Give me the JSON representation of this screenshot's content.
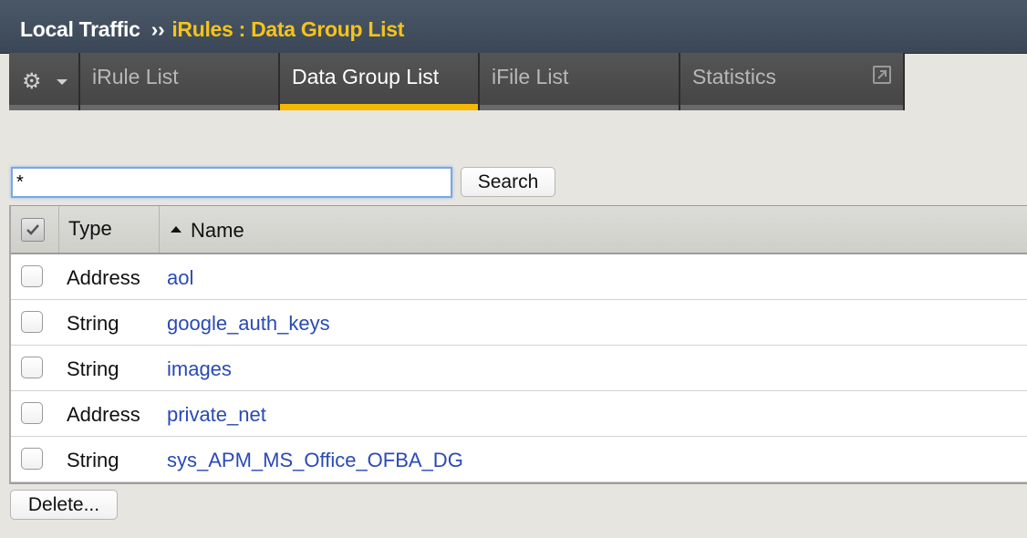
{
  "breadcrumb": {
    "section": "Local Traffic",
    "separator": "››",
    "page": "iRules : Data Group List"
  },
  "tabs": [
    {
      "label": "iRule List",
      "active": false
    },
    {
      "label": "Data Group List",
      "active": true
    },
    {
      "label": "iFile List",
      "active": false
    },
    {
      "label": "Statistics",
      "active": false
    }
  ],
  "search": {
    "value": "*",
    "button_label": "Search"
  },
  "table": {
    "columns": [
      "Type",
      "Name"
    ],
    "sort_column": "Name",
    "sort_direction": "ascending",
    "rows": [
      {
        "type": "Address",
        "name": "aol"
      },
      {
        "type": "String",
        "name": "google_auth_keys"
      },
      {
        "type": "String",
        "name": "images"
      },
      {
        "type": "Address",
        "name": "private_net"
      },
      {
        "type": "String",
        "name": "sys_APM_MS_Office_OFBA_DG"
      }
    ]
  },
  "actions": {
    "delete_label": "Delete..."
  },
  "colors": {
    "header_bg": "#3f4b5a",
    "breadcrumb_accent": "#f5c31c",
    "active_tab_underline": "#f5b800",
    "link": "#2a4ab3"
  }
}
